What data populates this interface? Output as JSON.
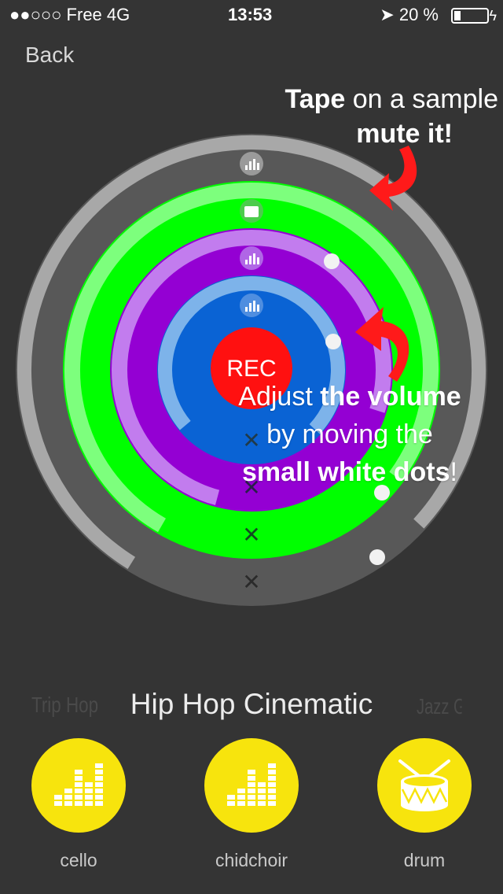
{
  "status_bar": {
    "carrier": "●●○○○ Free   4G",
    "time": "13:53",
    "battery_text": "20 %"
  },
  "nav": {
    "back_label": "Back"
  },
  "hints": {
    "tap_bold": "Tape",
    "tap_rest": " on a sample",
    "tap_line2": "mute it!",
    "vol_1": "Adjust ",
    "vol_1b": "the volume",
    "vol_2": "by moving the",
    "vol_3b": "small white dots",
    "vol_3": "!"
  },
  "rec_label": "REC",
  "mute_symbol": "✕",
  "rings": [
    {
      "name": "outer",
      "color": "#a8a8a8",
      "track": "#585858"
    },
    {
      "name": "green",
      "color": "#7dff7d",
      "track": "#00ff00"
    },
    {
      "name": "violet",
      "color": "#c27cee",
      "track": "#9400d3"
    },
    {
      "name": "blue",
      "color": "#7db3ea",
      "track": "#0a63d4"
    }
  ],
  "genres": {
    "prev": "Trip Hop",
    "current": "Hip Hop Cinematic",
    "next": "Jazz Groove"
  },
  "instruments": [
    {
      "label": "cello",
      "icon": "equalizer-icon"
    },
    {
      "label": "chidchoir",
      "icon": "equalizer-icon"
    },
    {
      "label": "drum",
      "icon": "drum-icon"
    }
  ],
  "colors": {
    "accent_yellow": "#f7e40d",
    "rec_red": "#ff1010",
    "arrow_red": "#ff1a1a",
    "mute_x": "#1f3a4a"
  }
}
